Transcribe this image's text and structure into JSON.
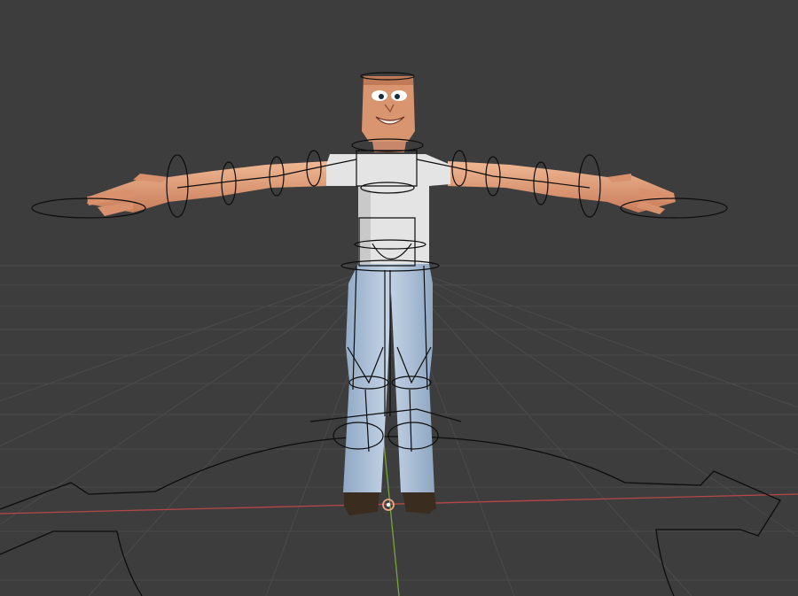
{
  "viewport": {
    "background": "#3d3d3d",
    "grid_color": "#4a4a4a",
    "x_axis_color": "#c04a4a",
    "y_axis_color": "#7fb03a",
    "rig_line_color": "#111111",
    "origin_color": "#d88a6a"
  },
  "character": {
    "skin_color": "#e2a07c",
    "shirt_color": "#e7e7e7",
    "jeans_color": "#b8cbe0",
    "shoe_color": "#3b2f22"
  },
  "icons": {
    "origin": "origin-marker-icon"
  }
}
